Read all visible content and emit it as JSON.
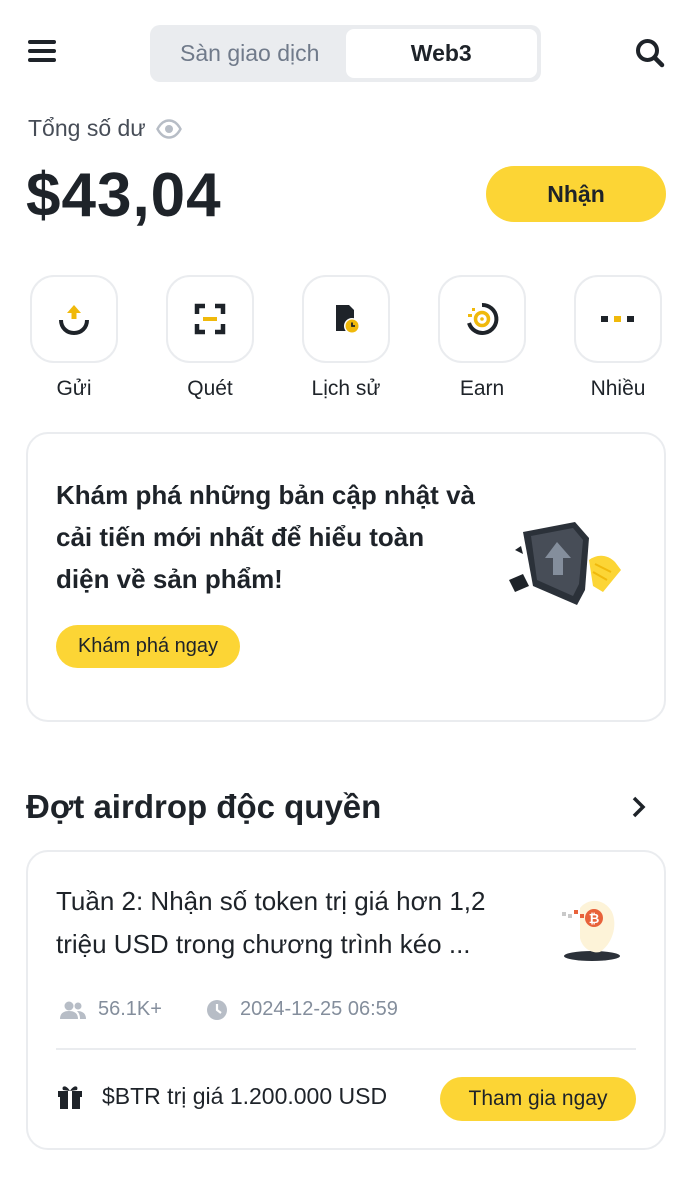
{
  "header": {
    "tabs": [
      {
        "label": "Sàn giao dịch",
        "active": false
      },
      {
        "label": "Web3",
        "active": true
      }
    ],
    "menu_icon": "hamburger-menu-icon",
    "search_icon": "search-icon"
  },
  "balance": {
    "label": "Tổng số dư",
    "value": "$43,04",
    "visibility_icon": "eye-icon",
    "receive_label": "Nhận"
  },
  "quick_actions": [
    {
      "label": "Gửi",
      "icon": "send-upload-icon"
    },
    {
      "label": "Quét",
      "icon": "scan-icon"
    },
    {
      "label": "Lịch sử",
      "icon": "history-icon"
    },
    {
      "label": "Earn",
      "icon": "earn-icon"
    },
    {
      "label": "Nhiều",
      "icon": "more-dots-icon"
    }
  ],
  "explore_card": {
    "text": "Khám phá những bản cập nhật và cải tiến mới nhất để hiểu toàn diện về sản phẩm!",
    "button_label": "Khám phá ngay",
    "illustration": "shield-upgrade-illustration"
  },
  "airdrop": {
    "section_title": "Đợt airdrop độc quyền",
    "card": {
      "title": "Tuần 2: Nhận số token trị giá hơn 1,2 triệu USD trong chương trình kéo ...",
      "participants": "56.1K+",
      "datetime": "2024-12-25 06:59",
      "reward": "$BTR trị giá 1.200.000 USD",
      "join_label": "Tham gia ngay",
      "illustration": "bitcoin-coin-illustration"
    }
  },
  "colors": {
    "accent": "#fcd535",
    "text_primary": "#1e2329",
    "text_secondary": "#848e9c",
    "border": "#eaecef"
  }
}
